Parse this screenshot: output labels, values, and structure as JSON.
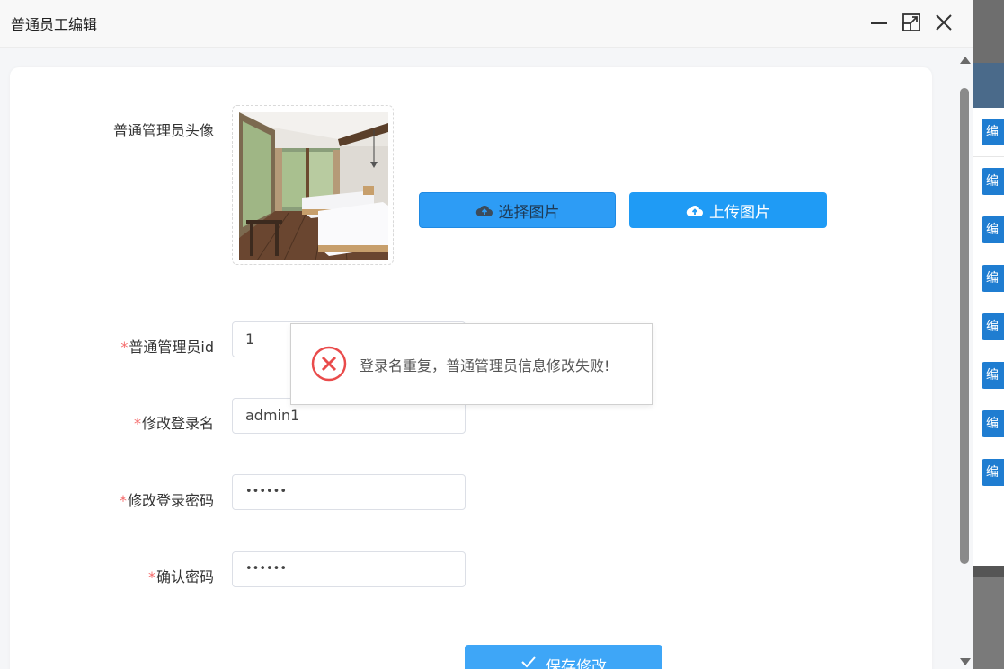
{
  "dialog": {
    "title": "普通员工编辑"
  },
  "form": {
    "avatar_label": "普通管理员头像",
    "select_image_label": "选择图片",
    "upload_image_label": "上传图片",
    "id_label": "普通管理员id",
    "id_value": "1",
    "login_name_label": "修改登录名",
    "login_name_value": "admin1",
    "password_label": "修改登录密码",
    "password_value": "••••••",
    "confirm_label": "确认密码",
    "confirm_value": "••••••",
    "required_mark": "*",
    "save_label": "保存修改"
  },
  "toast": {
    "message": "登录名重复，普通管理员信息修改失败!"
  },
  "background": {
    "row_button_text": "编"
  },
  "colors": {
    "primary": "#1f9bf5",
    "required": "#f56c6c",
    "error": "#e94b4b"
  }
}
